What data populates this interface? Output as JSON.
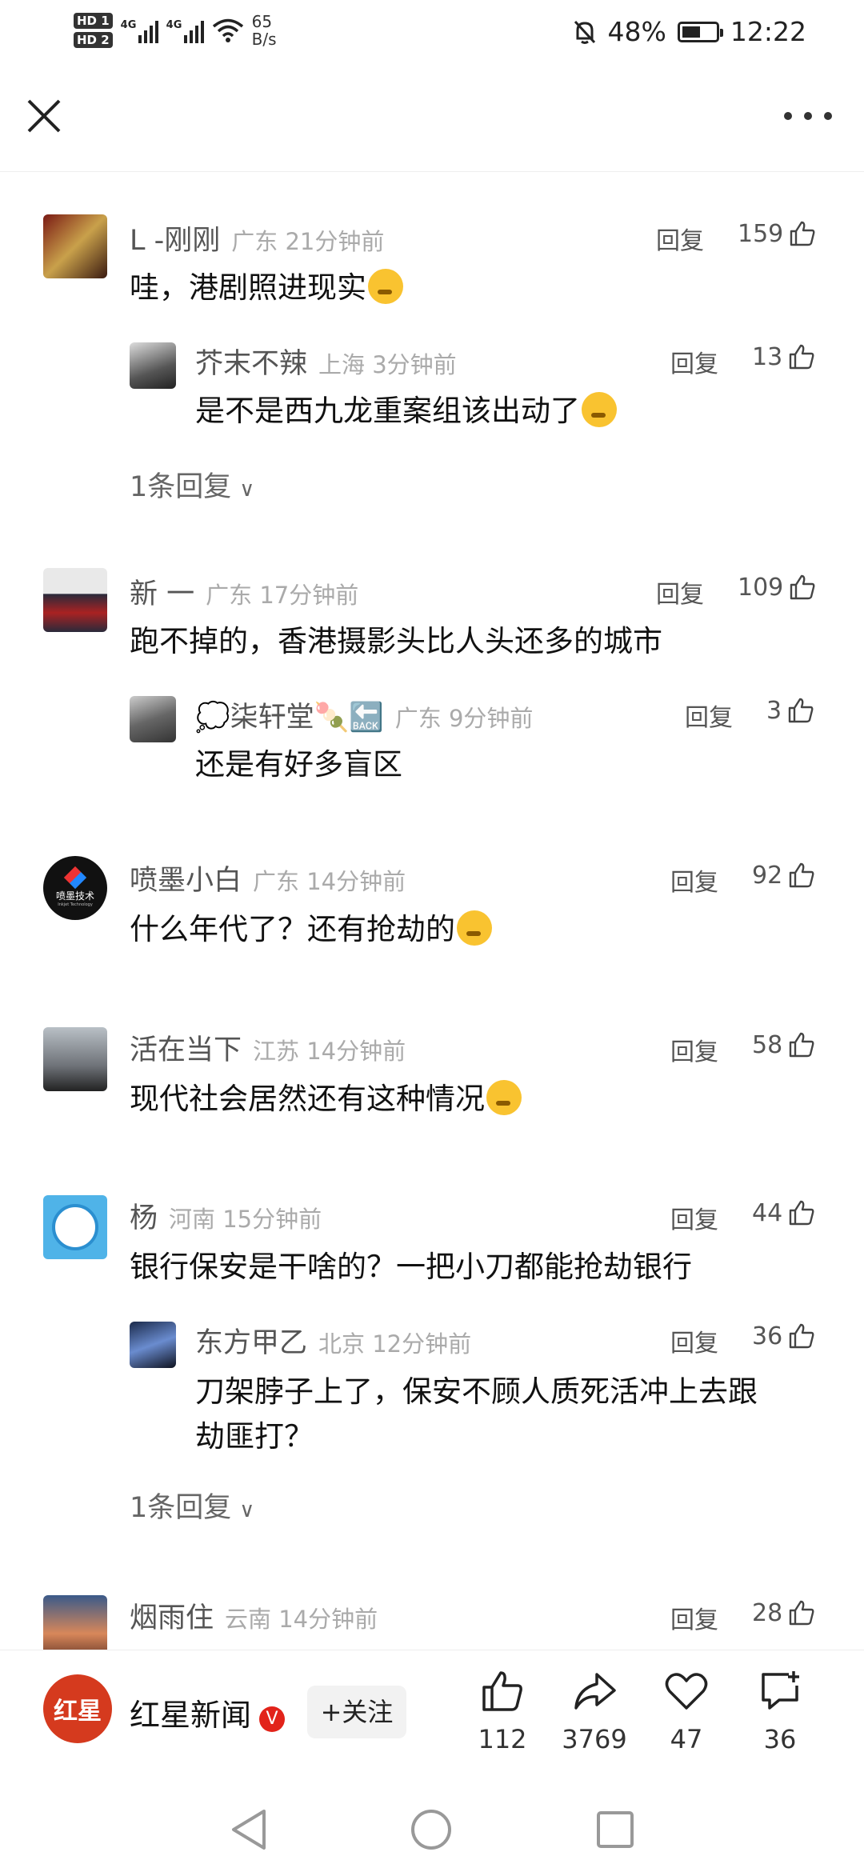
{
  "status_bar": {
    "hd1": "HD 1",
    "hd2": "HD 2",
    "net1": "4G",
    "net2": "4G",
    "speed_value": "65",
    "speed_unit": "B/s",
    "battery": "48%",
    "time": "12:22"
  },
  "comments": [
    {
      "name": "L -刚刚",
      "location": "广东 21分钟前",
      "reply_label": "回复",
      "likes": "159",
      "text": "哇，港剧照进现实",
      "emoji": true,
      "replies": [
        {
          "name": "芥末不辣",
          "location": "上海 3分钟前",
          "reply_label": "回复",
          "likes": "13",
          "text": "是不是西九龙重案组该出动了",
          "emoji": true
        }
      ],
      "more_replies": "1条回复"
    },
    {
      "name": "新 一",
      "location": "广东 17分钟前",
      "reply_label": "回复",
      "likes": "109",
      "text": "跑不掉的，香港摄影头比人头还多的城市",
      "emoji": false,
      "replies": [
        {
          "name": "💭柒轩堂🍡🔙",
          "location": "广东 9分钟前",
          "reply_label": "回复",
          "likes": "3",
          "text": "还是有好多盲区",
          "emoji": false
        }
      ]
    },
    {
      "name": "喷墨小白",
      "location": "广东 14分钟前",
      "reply_label": "回复",
      "likes": "92",
      "text": "什么年代了？还有抢劫的",
      "emoji": true,
      "avatar_text": "喷墨技术",
      "avatar_sub": "Inkjet Technology"
    },
    {
      "name": "活在当下",
      "location": "江苏 14分钟前",
      "reply_label": "回复",
      "likes": "58",
      "text": "现代社会居然还有这种情况",
      "emoji": true
    },
    {
      "name": "杨",
      "location": "河南 15分钟前",
      "reply_label": "回复",
      "likes": "44",
      "text": "银行保安是干啥的？一把小刀都能抢劫银行",
      "emoji": false,
      "replies": [
        {
          "name": "东方甲乙",
          "location": "北京 12分钟前",
          "reply_label": "回复",
          "likes": "36",
          "text_line1": "刀架脖子上了，保安不顾人质死活冲上去跟",
          "text_line2": "劫匪打？"
        }
      ],
      "more_replies": "1条回复"
    },
    {
      "name": "烟雨住",
      "location": "云南 14分钟前",
      "reply_label": "回复",
      "likes": "28"
    }
  ],
  "bottom_bar": {
    "logo_text": "红星",
    "brand": "红星新闻",
    "verified": "V",
    "follow_label": "+关注",
    "like_count": "112",
    "share_count": "3769",
    "fav_count": "47",
    "comment_count": "36"
  },
  "colors": {
    "brand_red": "#d53a1e",
    "verified_red": "#e2231a"
  }
}
